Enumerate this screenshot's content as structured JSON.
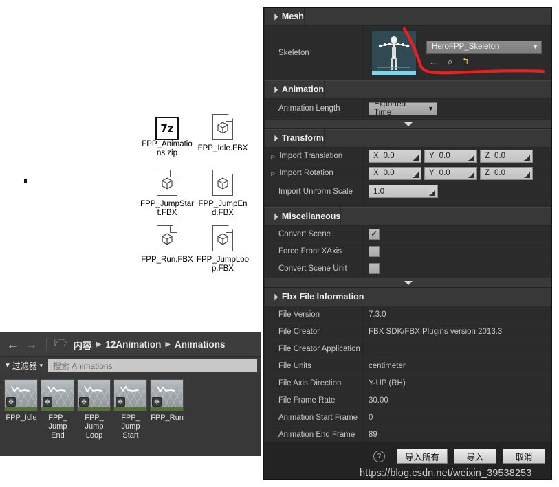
{
  "desktop": {
    "files": [
      {
        "name": "FPP_Animations.zip",
        "icon": "archive-7z-icon",
        "badge": "7z"
      },
      {
        "name": "FPP_Idle.FBX",
        "icon": "fbx-file-icon"
      },
      {
        "name": "FPP_JumpStart.FBX",
        "icon": "fbx-file-icon"
      },
      {
        "name": "FPP_JumpEnd.FBX",
        "icon": "fbx-file-icon"
      },
      {
        "name": "FPP_Run.FBX",
        "icon": "fbx-file-icon"
      },
      {
        "name": "FPP_JumpLoop.FBX",
        "icon": "fbx-file-icon"
      }
    ]
  },
  "content_browser": {
    "nav": {
      "back_icon": "arrow-left-icon",
      "forward_icon": "arrow-right-icon",
      "folder_icon": "folder-icon"
    },
    "breadcrumb": [
      "内容",
      "12Animation",
      "Animations"
    ],
    "breadcrumb_separator": "▶",
    "filter": {
      "label": "过滤器",
      "funnel_icon": "funnel-icon",
      "caret_icon": "chevron-down-icon"
    },
    "search": {
      "placeholder": "搜索 Animations",
      "value": ""
    },
    "assets": [
      {
        "name": "FPP_Idle"
      },
      {
        "name": "FPP_\nJump\nEnd"
      },
      {
        "name": "FPP_\nJump\nLoop"
      },
      {
        "name": "FPP_\nJump\nStart"
      },
      {
        "name": "FPP_Run"
      }
    ]
  },
  "dialog": {
    "sections": {
      "mesh": {
        "title": "Mesh",
        "skeleton_label": "Skeleton",
        "skeleton_value": "HeroFPP_Skeleton",
        "skeleton_thumb": "skeleton-preview-thumbnail",
        "mini_icons": [
          "arrow-left-icon",
          "browse-magnifier-icon",
          "reset-arrow-icon"
        ]
      },
      "animation": {
        "title": "Animation",
        "length_label": "Animation Length",
        "length_value": "Exported Time"
      },
      "transform": {
        "title": "Transform",
        "translation_label": "Import Translation",
        "rotation_label": "Import Rotation",
        "uniform_scale_label": "Import Uniform Scale",
        "translation": {
          "x": "0.0",
          "y": "0.0",
          "z": "0.0"
        },
        "rotation": {
          "x": "0.0",
          "y": "0.0",
          "z": "0.0"
        },
        "uniform_scale": "1.0",
        "axis_x": "X",
        "axis_y": "Y",
        "axis_z": "Z"
      },
      "miscellaneous": {
        "title": "Miscellaneous",
        "items": [
          {
            "label": "Convert Scene",
            "checked": true
          },
          {
            "label": "Force Front XAxis",
            "checked": false
          },
          {
            "label": "Convert Scene Unit",
            "checked": false
          }
        ],
        "check_glyph": "✔"
      },
      "fbx_info": {
        "title": "Fbx File Information",
        "rows": [
          {
            "label": "File Version",
            "value": "7.3.0"
          },
          {
            "label": "File Creator",
            "value": "FBX SDK/FBX Plugins version 2013.3"
          },
          {
            "label": "File Creator Application",
            "value": ""
          },
          {
            "label": "File Units",
            "value": "centimeter"
          },
          {
            "label": "File Axis Direction",
            "value": "Y-UP (RH)"
          },
          {
            "label": "File Frame Rate",
            "value": "30.00"
          },
          {
            "label": "Animation Start Frame",
            "value": "0"
          },
          {
            "label": "Animation End Frame",
            "value": "89"
          }
        ]
      }
    },
    "footer": {
      "help_icon": "help-question-icon",
      "import_all_label": "导入所有",
      "import_label": "导入",
      "cancel_label": "取消"
    },
    "expander_glyph": "▼"
  },
  "annotation": {
    "color": "#ef1d1d"
  },
  "watermark": "https://blog.csdn.net/weixin_39538253"
}
